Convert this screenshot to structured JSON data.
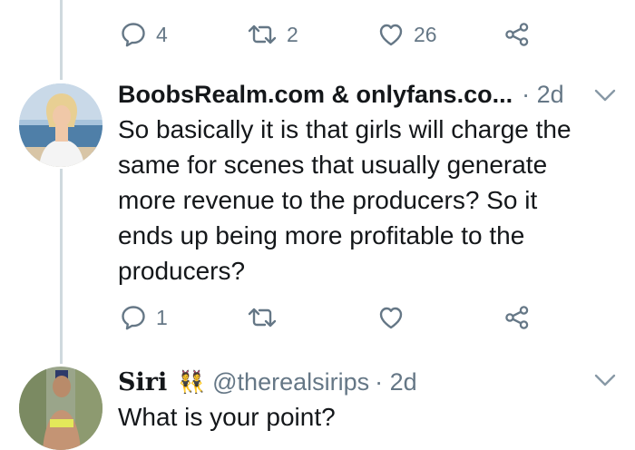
{
  "colors": {
    "text": "#14171a",
    "muted": "#657786",
    "thread_line": "#cfd9de",
    "background": "#ffffff"
  },
  "top_actions": {
    "reply_count": "4",
    "retweet_count": "2",
    "like_count": "26",
    "icons": [
      "reply-icon",
      "retweet-icon",
      "like-icon",
      "share-icon"
    ]
  },
  "tweet1": {
    "display_name": "BoobsRealm.com & onlyfans.co...",
    "time": "· 2d",
    "text_lines": [
      "So basically it is that girls will charge the",
      "same for scenes that usually generate",
      "more revenue to the producers? So it",
      "ends up being more profitable to the",
      "producers?"
    ],
    "actions": {
      "reply_count": "1",
      "retweet_count": "",
      "like_count": ""
    }
  },
  "tweet2": {
    "display_name": "Siri",
    "emoji": "👯",
    "handle": "@therealsirips",
    "time": "· 2d",
    "text_lines": [
      "What is your point?"
    ]
  }
}
